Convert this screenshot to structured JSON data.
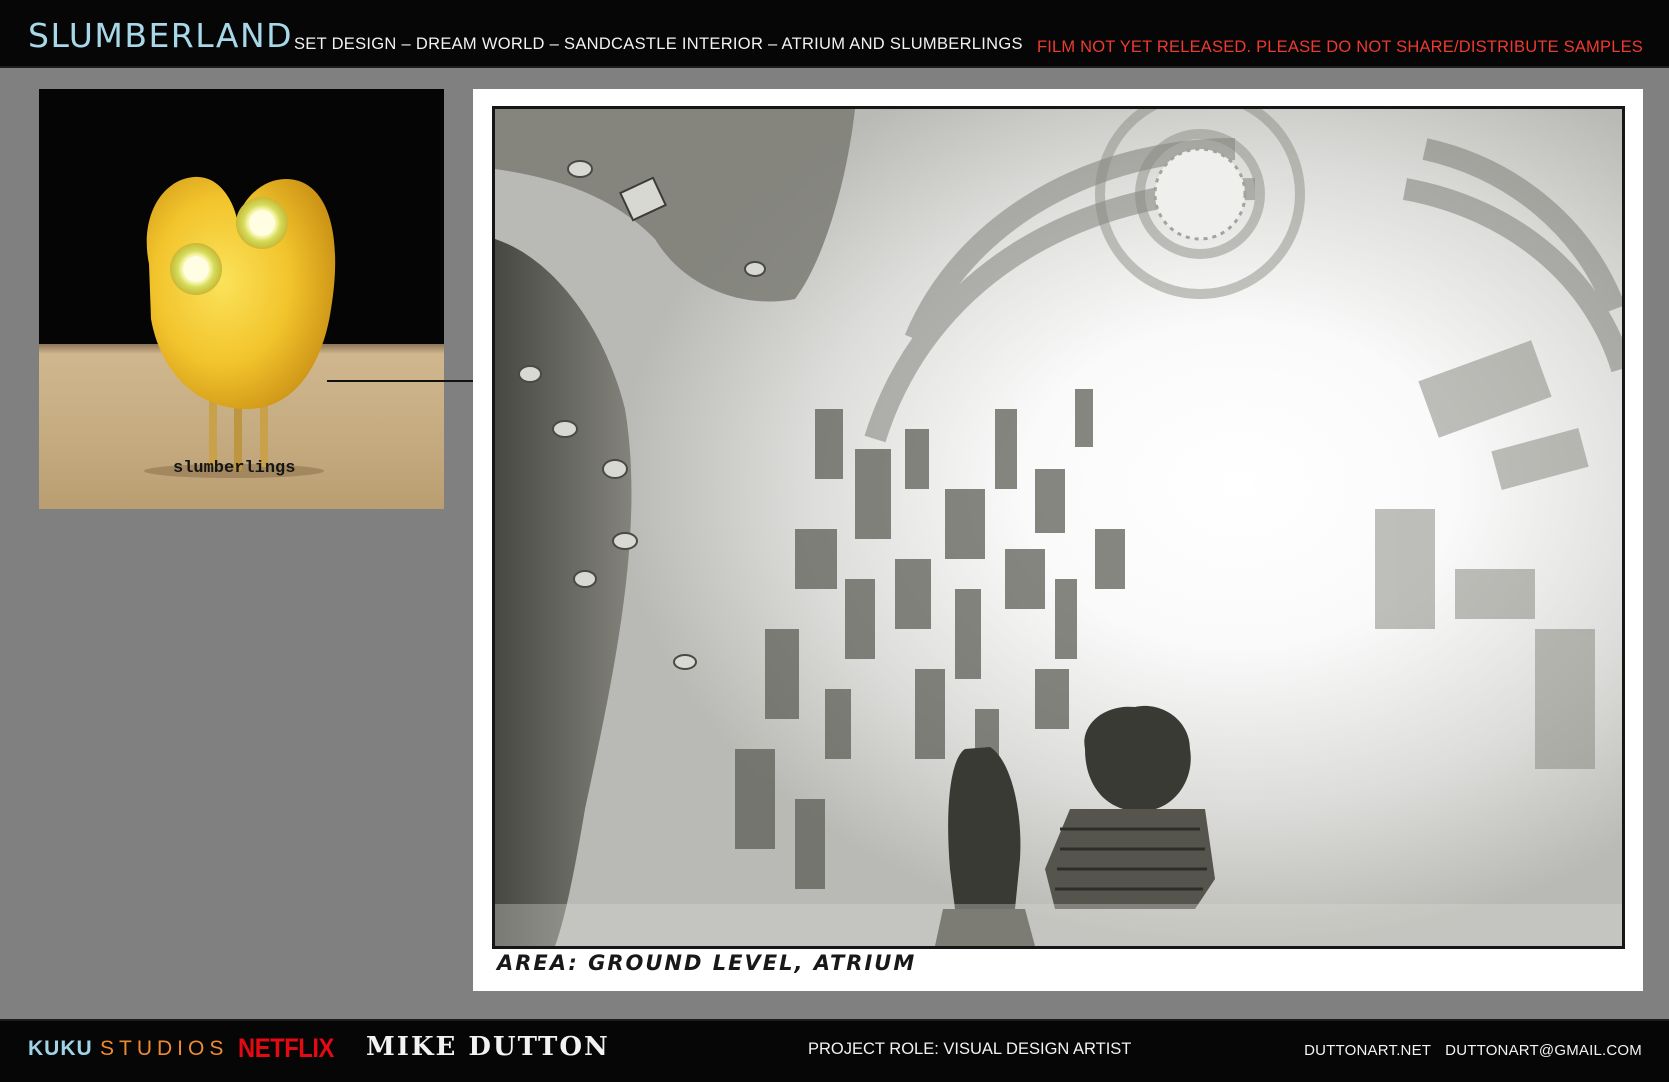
{
  "header": {
    "title": "SLUMBERLAND",
    "subtitle": "SET DESIGN – DREAM WORLD –  SANDCASTLE INTERIOR – ATRIUM AND SLUMBERLINGS",
    "notice": "FILM NOT YET RELEASED. PLEASE DO NOT SHARE/DISTRIBUTE SAMPLES"
  },
  "reference": {
    "label": "slumberlings"
  },
  "sketch": {
    "caption": "AREA: GROUND LEVEL, ATRIUM"
  },
  "footer": {
    "studio_brand": "KUKU",
    "studio_word": "STUDIOS",
    "network": "NETFLIX",
    "artist": "MIKE DUTTON",
    "role": "PROJECT ROLE: VISUAL DESIGN ARTIST",
    "website": "DUTTONART.NET",
    "email": "DUTTONART@GMAIL.COM"
  },
  "colors": {
    "title": "#a7d8ea",
    "notice": "#ef3a2f",
    "page_background": "#808080",
    "kuku": "#9fd3e8",
    "studios": "#ef8a30",
    "netflix": "#e50914"
  }
}
